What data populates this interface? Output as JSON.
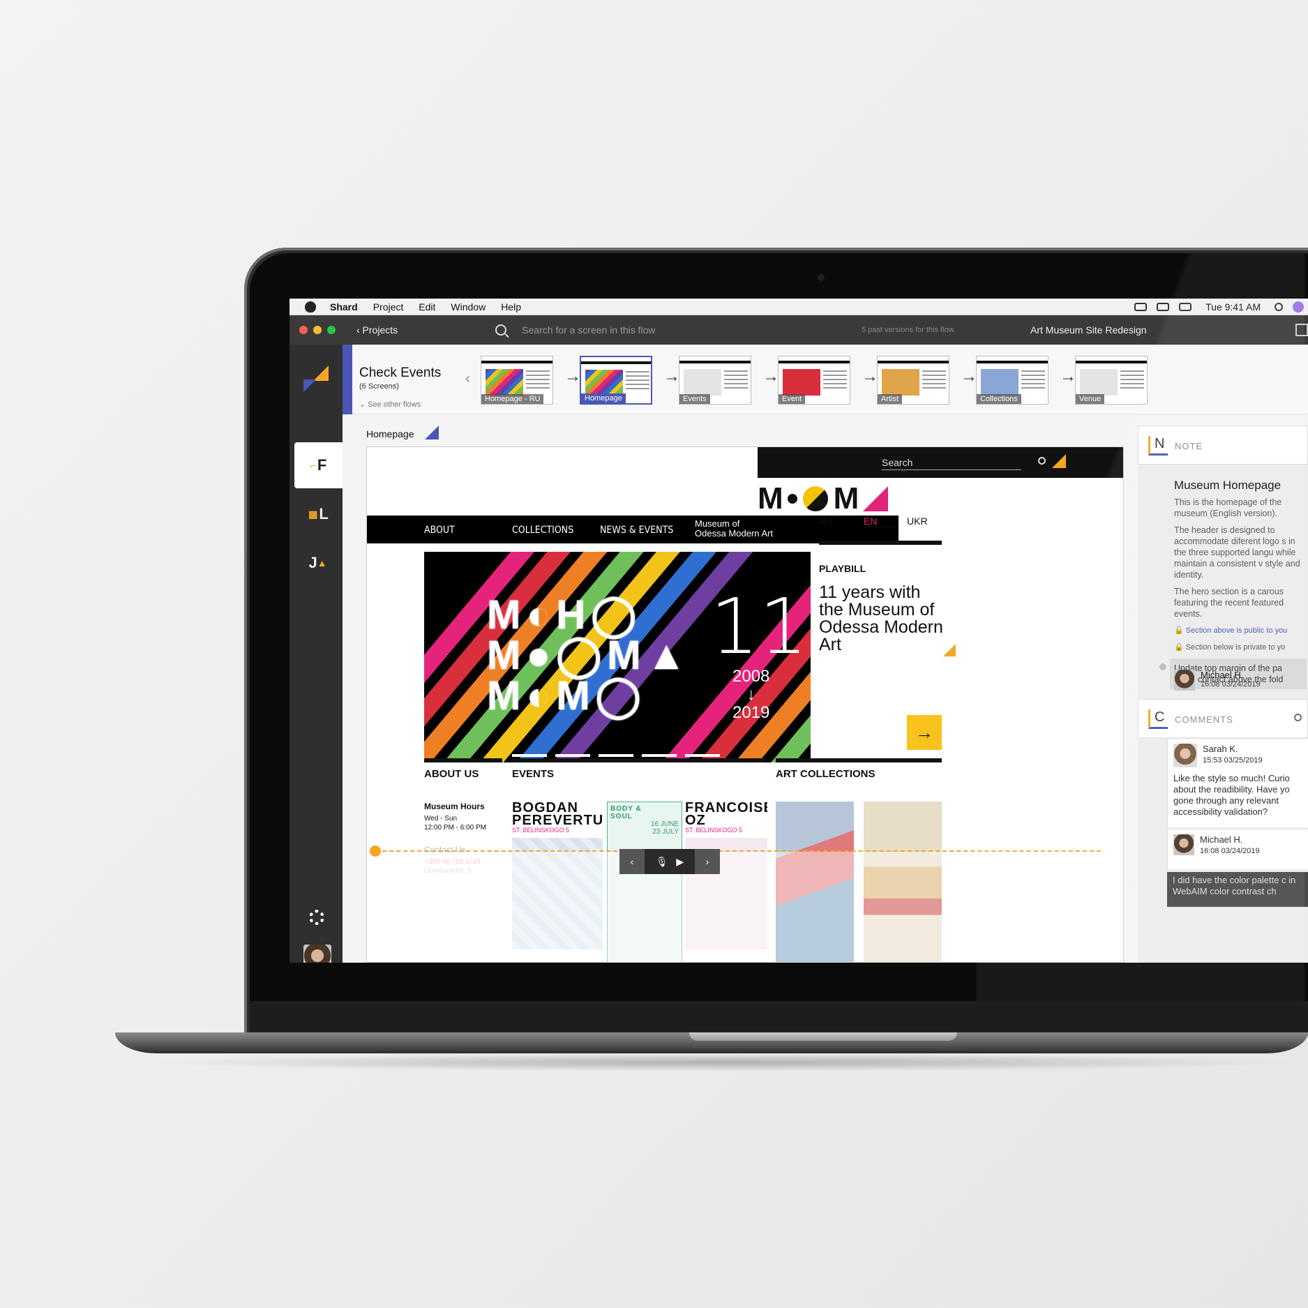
{
  "menubar": {
    "app_name": "Shard",
    "items": [
      "Project",
      "Edit",
      "Window",
      "Help"
    ],
    "time": "Tue 9:41 AM"
  },
  "titlebar": {
    "back_label": "‹ Projects",
    "search_placeholder": "Search for a screen in this flow",
    "versions": "5 past versions for this flow",
    "project_name": "Art Museum Site Redesign"
  },
  "sidebar": {
    "tabs": [
      {
        "icon": "flows-icon",
        "label": "F"
      },
      {
        "icon": "layouts-icon",
        "label": "L"
      },
      {
        "icon": "journeys-icon",
        "label": "J"
      }
    ]
  },
  "flow": {
    "title": "Check Events",
    "subtitle": "(6 Screens)",
    "other": "See other flows",
    "screens": [
      "Homepage - RU",
      "Homepage",
      "Events",
      "Event",
      "Artist",
      "Collections",
      "Venue"
    ],
    "selected": "Homepage"
  },
  "canvas": {
    "label": "Homepage"
  },
  "site": {
    "search": "Search",
    "nav": [
      "ABOUT",
      "COLLECTIONS",
      "NEWS & EVENTS"
    ],
    "museum_line1": "Museum of",
    "museum_line2": "Odessa Modern Art",
    "languages": [
      "RU",
      "EN",
      "UKR"
    ],
    "hero": {
      "number": "11",
      "year_start": "2008",
      "year_end": "2019",
      "down_arrow": "↓"
    },
    "playbill": "PLAYBILL",
    "headline": "11 years with the Museum of Odessa Modern Art",
    "go_arrow": "→",
    "sections": [
      "ABOUT US",
      "EVENTS",
      "ART COLLECTIONS"
    ],
    "hours_title": "Museum Hours",
    "hours_days": "Wed - Sun",
    "hours_time": "12:00 PM - 6:00 PM",
    "contact_title": "Contact Us",
    "contact_phone": "+380 48 759 1018",
    "contact_addr": "Leontovycha, 5",
    "events": [
      {
        "title1": "BOGDAN",
        "title2": "PEREVERTUN",
        "address": "ST. BELINSKOGO 5"
      },
      {
        "title1": "BODY &",
        "title2": "SOUL",
        "dates1": "16 JUNE",
        "dates2": "23 JULY"
      },
      {
        "title1": "FRANCOISE",
        "title2": "OZ",
        "address": "ST. BELINSKOGO 5"
      }
    ]
  },
  "note": {
    "section_label": "NOTE",
    "title": "Museum Homepage",
    "p1": "This is the homepage of the museum (English version).",
    "p2": "The header is designed to accommodate diferent logo s in the three supported langu while maintain a consistent v style and identity.",
    "p3": "The hero section is a carous featuring the recent featured events.",
    "public_line": "Section above is public to you",
    "private_line": "Section below is private to yo",
    "private_text": "Update top margin of the pa Move contact above the fold",
    "author": "Michael H.",
    "author_time": "16:08  03/24/2019"
  },
  "comments": {
    "section_label": "COMMENTS",
    "items": [
      {
        "author": "Sarah K.",
        "time": "15:53  03/25/2019",
        "text": "Like the style so much! Curio about the readibility. Have yo gone through any relevant accessibility validation?"
      },
      {
        "author": "Michael H.",
        "time": "16:08  03/24/2019",
        "text": "I did have the color palette c in WebAIM color contrast ch"
      }
    ]
  },
  "colors": {
    "accent_blue": "#4a57b5",
    "accent_orange": "#f5a623",
    "brand_pink": "#e0237b",
    "brand_yellow": "#f7c31c"
  }
}
